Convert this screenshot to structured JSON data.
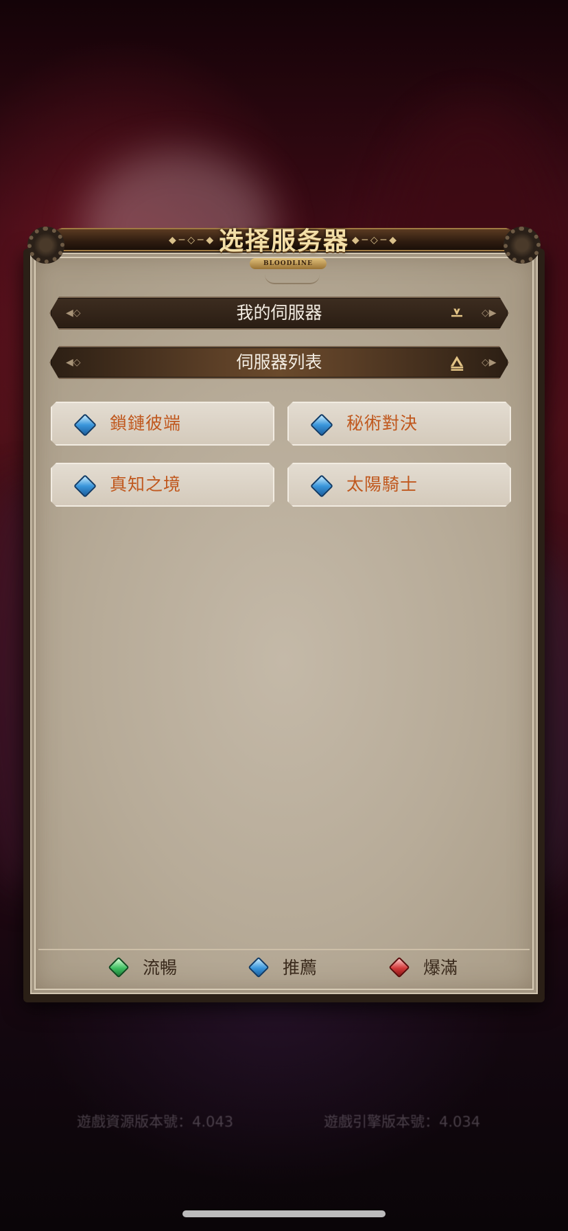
{
  "dialog": {
    "title": "选择服务器",
    "logo_text": "BLOODLINE"
  },
  "sections": {
    "my_servers": {
      "label": "我的伺服器",
      "state": "collapsed",
      "arrow_icon": "chevron-down-icon"
    },
    "server_list": {
      "label": "伺服器列表",
      "state": "expanded",
      "arrow_icon": "chevron-up-icon"
    }
  },
  "servers": [
    {
      "name": "鎖鏈彼端",
      "status": "推薦",
      "status_color": "#3a96db"
    },
    {
      "name": "秘術對決",
      "status": "推薦",
      "status_color": "#3a96db"
    },
    {
      "name": "真知之境",
      "status": "推薦",
      "status_color": "#3a96db"
    },
    {
      "name": "太陽騎士",
      "status": "推薦",
      "status_color": "#3a96db"
    }
  ],
  "legend": [
    {
      "label": "流暢",
      "color": "#3fbf62",
      "icon": "green-gem-icon"
    },
    {
      "label": "推薦",
      "color": "#3a96db",
      "icon": "blue-gem-icon"
    },
    {
      "label": "爆滿",
      "color": "#d23a3a",
      "icon": "red-gem-icon"
    }
  ],
  "footer": {
    "resource_version": "遊戲資源版本號：4.043",
    "engine_version": "遊戲引擎版本號：4.034"
  },
  "colors": {
    "server_name": "#c0581e",
    "title": "#f3dfa8",
    "header_text": "#f4eee4"
  }
}
